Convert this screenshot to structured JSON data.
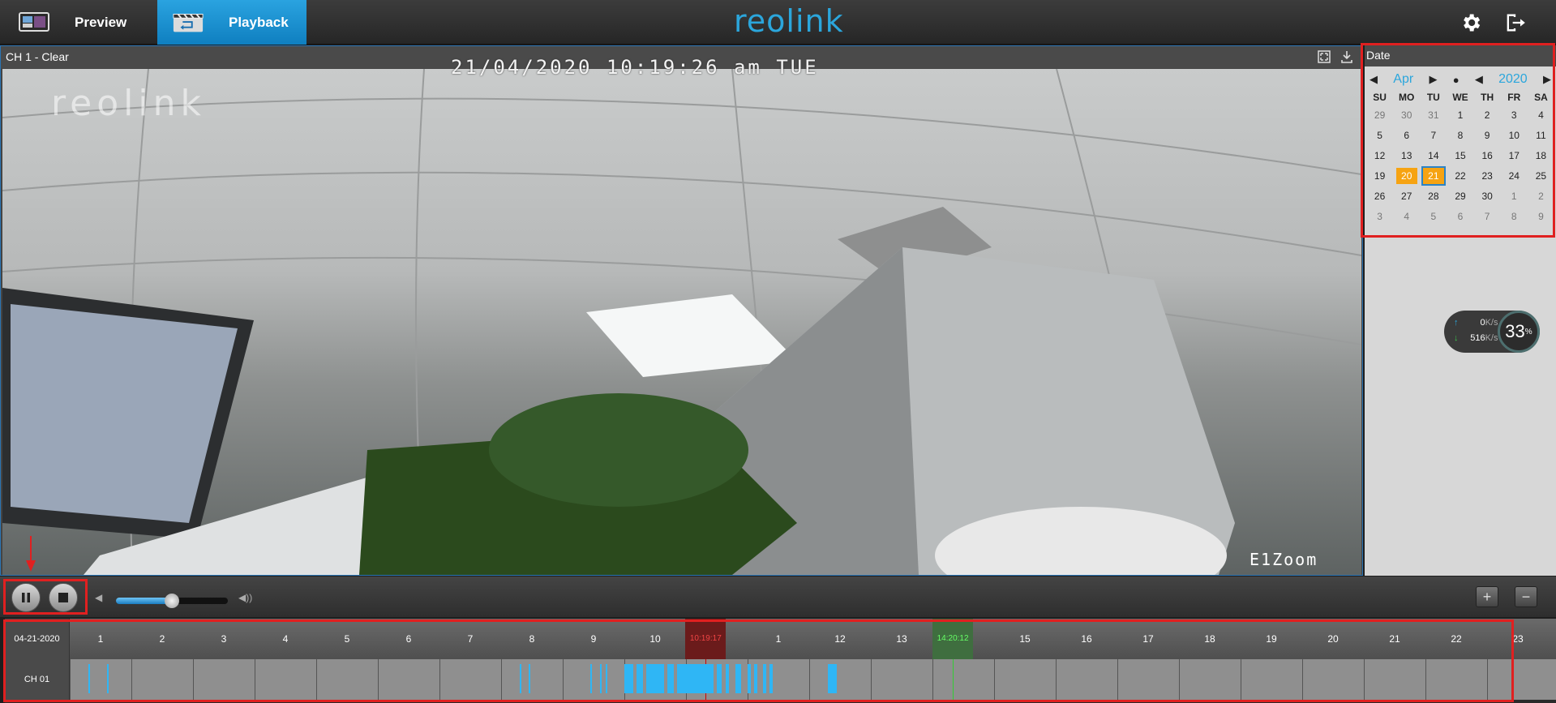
{
  "header": {
    "tabs": [
      {
        "label": "Preview",
        "icon": "preview-monitor-icon"
      },
      {
        "label": "Playback",
        "icon": "playback-clapper-icon",
        "active": true
      }
    ],
    "logo": "reolink",
    "settings_icon": "gear-icon",
    "logout_icon": "logout-icon"
  },
  "video": {
    "title": "CH 1 - Clear",
    "osd_timestamp": "21/04/2020 10:19:26 am TUE",
    "watermark": "reolink",
    "model": "E1Zoom"
  },
  "date_panel": {
    "title": "Date",
    "month": "Apr",
    "year": "2020",
    "weekdays": [
      "SU",
      "MO",
      "TU",
      "WE",
      "TH",
      "FR",
      "SA"
    ],
    "days": [
      [
        "29",
        "30",
        "31",
        "1",
        "2",
        "3",
        "4"
      ],
      [
        "5",
        "6",
        "7",
        "8",
        "9",
        "10",
        "11"
      ],
      [
        "12",
        "13",
        "14",
        "15",
        "16",
        "17",
        "18"
      ],
      [
        "19",
        "20",
        "21",
        "22",
        "23",
        "24",
        "25"
      ],
      [
        "26",
        "27",
        "28",
        "29",
        "30",
        "1",
        "2"
      ],
      [
        "3",
        "4",
        "5",
        "6",
        "7",
        "8",
        "9"
      ]
    ],
    "recorded_days": [
      "20",
      "21"
    ],
    "selected_day": "21"
  },
  "network": {
    "upload": "0",
    "upload_unit": "K/s",
    "download": "516",
    "download_unit": "K/s",
    "percent": "33",
    "percent_unit": "%"
  },
  "controls": {
    "pause_icon": "pause-icon",
    "stop_icon": "stop-icon",
    "volume_level": 0.5,
    "zoom_in": "+",
    "zoom_out": "−"
  },
  "timeline": {
    "date": "04-21-2020",
    "channel": "CH 01",
    "hours": [
      "1",
      "2",
      "3",
      "4",
      "5",
      "6",
      "7",
      "8",
      "9",
      "10",
      "",
      "1",
      "12",
      "13",
      "",
      "15",
      "16",
      "17",
      "18",
      "19",
      "20",
      "21",
      "22",
      "23"
    ],
    "current_time": "10:19:17",
    "other_time": "14:20:12"
  }
}
